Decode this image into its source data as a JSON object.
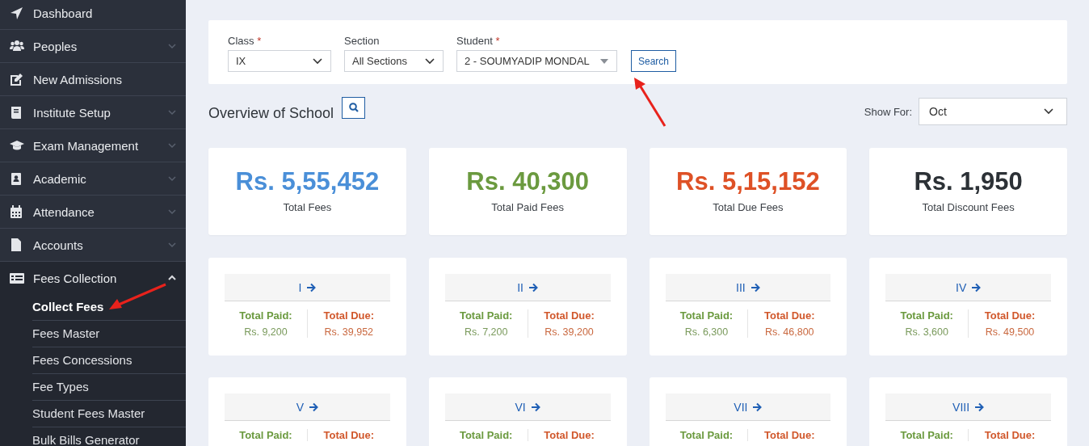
{
  "sidebar": {
    "items": [
      {
        "label": "Dashboard",
        "submenu": false,
        "expanded": false
      },
      {
        "label": "Peoples",
        "submenu": true,
        "expanded": false
      },
      {
        "label": "New Admissions",
        "submenu": false,
        "expanded": false
      },
      {
        "label": "Institute Setup",
        "submenu": true,
        "expanded": false
      },
      {
        "label": "Exam Management",
        "submenu": true,
        "expanded": false
      },
      {
        "label": "Academic",
        "submenu": true,
        "expanded": false
      },
      {
        "label": "Attendance",
        "submenu": true,
        "expanded": false
      },
      {
        "label": "Accounts",
        "submenu": true,
        "expanded": false
      },
      {
        "label": "Fees Collection",
        "submenu": true,
        "expanded": true,
        "children": [
          {
            "label": "Collect Fees",
            "selected": true
          },
          {
            "label": "Fees Master",
            "selected": false
          },
          {
            "label": "Fees Concessions",
            "selected": false
          },
          {
            "label": "Fee Types",
            "selected": false
          },
          {
            "label": "Student Fees Master",
            "selected": false
          },
          {
            "label": "Bulk Bills Generator",
            "selected": false
          }
        ]
      }
    ]
  },
  "filters": [
    {
      "label": "Class",
      "required_mark": "*",
      "value": "IX",
      "kind": "select"
    },
    {
      "label": "Section",
      "value": "All Sections",
      "kind": "select"
    },
    {
      "label": "Student",
      "required_mark": "*",
      "value": "2 - SOUMYADIP MONDAL",
      "kind": "combo"
    }
  ],
  "search_button": "Search",
  "overview": {
    "title": "Overview of School",
    "show_for_label": "Show For:",
    "show_for_value": "Oct"
  },
  "stats": [
    {
      "value": "Rs. 5,55,452",
      "label": "Total Fees",
      "color": "#4a8fd8"
    },
    {
      "value": "Rs. 40,300",
      "label": "Total Paid Fees",
      "color": "#6b9a3f"
    },
    {
      "value": "Rs. 5,15,152",
      "label": "Total Due Fees",
      "color": "#de5126"
    },
    {
      "value": "Rs. 1,950",
      "label": "Total Discount Fees",
      "color": "#2c3136"
    }
  ],
  "classes": [
    {
      "name": "I",
      "paid_label": "Total Paid:",
      "paid": "Rs. 9,200",
      "due_label": "Total Due:",
      "due": "Rs. 39,952"
    },
    {
      "name": "II",
      "paid_label": "Total Paid:",
      "paid": "Rs. 7,200",
      "due_label": "Total Due:",
      "due": "Rs. 39,200"
    },
    {
      "name": "III",
      "paid_label": "Total Paid:",
      "paid": "Rs. 6,300",
      "due_label": "Total Due:",
      "due": "Rs. 46,800"
    },
    {
      "name": "IV",
      "paid_label": "Total Paid:",
      "paid": "Rs. 3,600",
      "due_label": "Total Due:",
      "due": "Rs. 49,500"
    },
    {
      "name": "V",
      "paid_label": "Total Paid:",
      "due_label": "Total Due:"
    },
    {
      "name": "VI",
      "paid_label": "Total Paid:",
      "due_label": "Total Due:"
    },
    {
      "name": "VII",
      "paid_label": "Total Paid:",
      "due_label": "Total Due:"
    },
    {
      "name": "VIII",
      "paid_label": "Total Paid:",
      "due_label": "Total Due:"
    }
  ]
}
